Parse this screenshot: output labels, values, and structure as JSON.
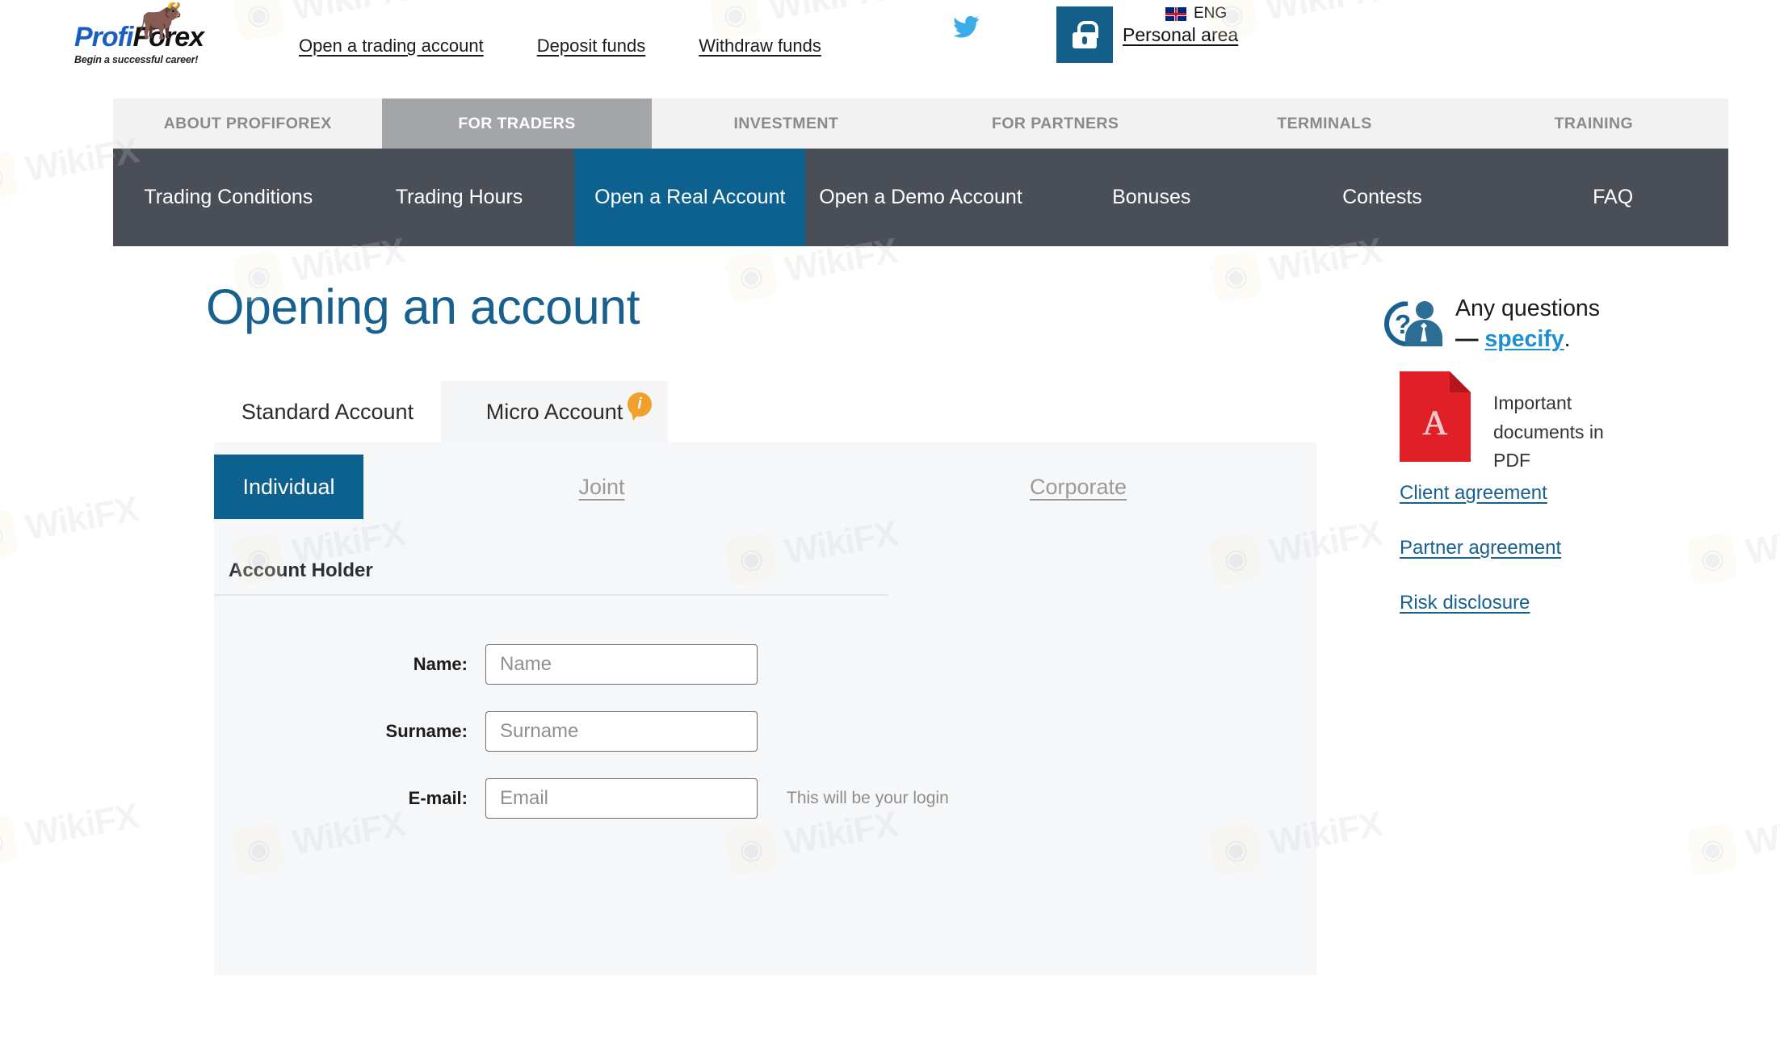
{
  "header": {
    "logo": {
      "brand_part1": "Profi",
      "brand_part2": "Forex",
      "tagline": "Begin a successful career!"
    },
    "links": [
      "Open a trading account",
      "Deposit funds",
      "Withdraw funds"
    ],
    "twitter_icon": "twitter-bird-icon",
    "lock_icon": "padlock-icon",
    "language_code": "ENG",
    "personal_area": "Personal area"
  },
  "main_nav": [
    {
      "label": "ABOUT PROFIFOREX",
      "active": false
    },
    {
      "label": "FOR TRADERS",
      "active": true
    },
    {
      "label": "INVESTMENT",
      "active": false
    },
    {
      "label": "FOR PARTNERS",
      "active": false
    },
    {
      "label": "TERMINALS",
      "active": false
    },
    {
      "label": "TRAINING",
      "active": false
    }
  ],
  "sub_nav": [
    {
      "label": "Trading Conditions",
      "active": false
    },
    {
      "label": "Trading Hours",
      "active": false
    },
    {
      "label": "Open a Real Account",
      "active": true
    },
    {
      "label": "Open a Demo Account",
      "active": false
    },
    {
      "label": "Bonuses",
      "active": false
    },
    {
      "label": "Contests",
      "active": false
    },
    {
      "label": "FAQ",
      "active": false
    }
  ],
  "page": {
    "title": "Opening an account"
  },
  "questions": {
    "icon": "support-agent-question-icon",
    "line1": "Any questions",
    "dash": "—",
    "link": "specify",
    "period": "."
  },
  "pdf_block": {
    "icon": "pdf-file-icon",
    "label": "Important documents in PDF",
    "links": [
      "Client agreement",
      "Partner agreement",
      "Risk disclosure"
    ]
  },
  "account_tabs": [
    {
      "label": "Standard Account",
      "active": true,
      "badge": ""
    },
    {
      "label": "Micro Account",
      "active": false,
      "badge": "i"
    }
  ],
  "holder_type_tabs": [
    {
      "label": "Individual",
      "active": true
    },
    {
      "label": "Joint",
      "active": false
    },
    {
      "label": "Corporate",
      "active": false
    }
  ],
  "form": {
    "section_title": "Account Holder",
    "fields": [
      {
        "label": "Name:",
        "placeholder": "Name",
        "value": "",
        "hint": ""
      },
      {
        "label": "Surname:",
        "placeholder": "Surname",
        "value": "",
        "hint": ""
      },
      {
        "label": "E-mail:",
        "placeholder": "Email",
        "value": "",
        "hint": "This will be your login"
      }
    ]
  },
  "watermark": {
    "text": "WikiFX",
    "badge_glyph": "◉"
  },
  "colors": {
    "brand_blue": "#0d618f",
    "title_blue": "#18618e",
    "subnav_dark": "#4a4e57",
    "mainnav_bg": "#f2f2f2",
    "mainnav_active": "#a3a5a8",
    "accent_orange": "#f0a02b",
    "pdf_red": "#e01f26",
    "link_blue": "#1f8fd0",
    "panel_bg": "#f6f7f9"
  }
}
